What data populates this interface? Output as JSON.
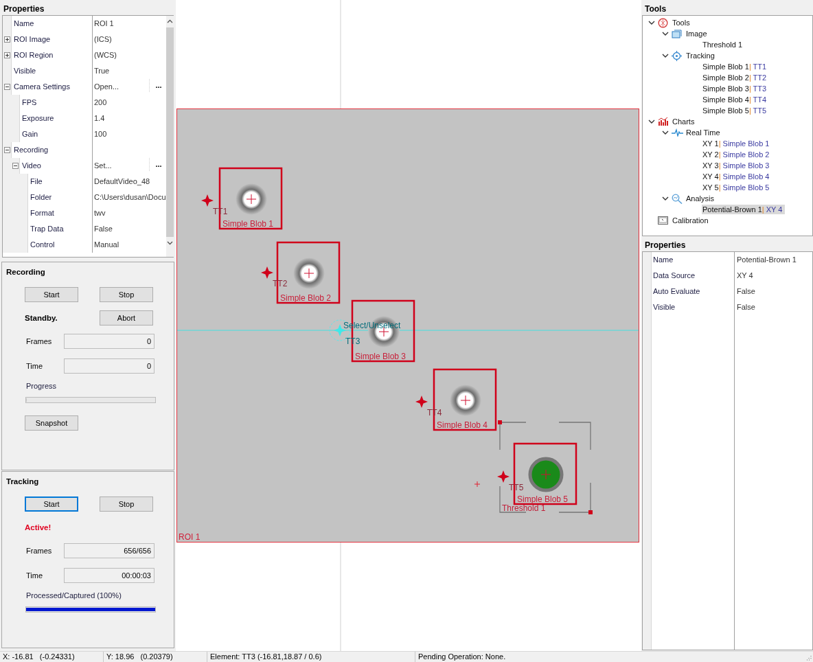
{
  "left_properties": {
    "title": "Properties",
    "rows": [
      {
        "name": "Name",
        "value": "ROI 1"
      },
      {
        "name": "ROI Image",
        "value": "(ICS)",
        "expanded": false
      },
      {
        "name": "ROI Region",
        "value": "(WCS)",
        "expanded": false
      },
      {
        "name": "Visible",
        "value": "True"
      },
      {
        "name": "Camera Settings",
        "value": "Open...",
        "button": "...",
        "expanded": true,
        "children": [
          {
            "name": "FPS",
            "value": "200"
          },
          {
            "name": "Exposure",
            "value": "1.4"
          },
          {
            "name": "Gain",
            "value": "100"
          }
        ]
      },
      {
        "name": "Recording",
        "value": "",
        "expanded": true,
        "children": [
          {
            "name": "Video",
            "value": "Set...",
            "button": "...",
            "expanded": true,
            "children": [
              {
                "name": "File",
                "value": "DefaultVideo_48"
              },
              {
                "name": "Folder",
                "value": "C:\\Users\\dusan\\Docu"
              },
              {
                "name": "Format",
                "value": "twv"
              },
              {
                "name": "Trap Data",
                "value": "False"
              },
              {
                "name": "Control",
                "value": "Manual"
              }
            ]
          }
        ]
      }
    ]
  },
  "recording": {
    "title": "Recording",
    "start": {
      "label": "Start",
      "focused": false
    },
    "stop": "Stop",
    "abort": "Abort",
    "status": {
      "text": "Standby.",
      "kind": "idle"
    },
    "fields": [
      {
        "label": "Frames",
        "value": "0"
      },
      {
        "label": "Time",
        "value": "0"
      }
    ],
    "progress_label": "Progress",
    "progress": {
      "level": 0
    },
    "snapshot": "Snapshot"
  },
  "tracking": {
    "title": "Tracking",
    "start": {
      "label": "Start",
      "focused": true
    },
    "stop": "Stop",
    "status": {
      "text": "Active!",
      "kind": "active"
    },
    "fields": [
      {
        "label": "Frames",
        "value": "656/656"
      },
      {
        "label": "Time",
        "value": "00:00:03"
      }
    ],
    "progress_label": "Processed/Captured (100%)",
    "progress": {
      "level": 1
    }
  },
  "canvas": {
    "roi_label": "ROI 1",
    "selection_hint": "Select/Unselect",
    "threshold_label": "Threshold 1",
    "blobs": [
      {
        "label": "Simple Blob 1",
        "tracker": "TT1",
        "selected": false,
        "detected": false
      },
      {
        "label": "Simple Blob 2",
        "tracker": "TT2",
        "selected": false,
        "detected": false
      },
      {
        "label": "Simple Blob 3",
        "tracker": "TT3",
        "selected": true,
        "detected": false
      },
      {
        "label": "Simple Blob 4",
        "tracker": "TT4",
        "selected": false,
        "detected": false
      },
      {
        "label": "Simple Blob 5",
        "tracker": "TT5",
        "selected": false,
        "detected": true
      }
    ]
  },
  "tools": {
    "title": "Tools",
    "tree": [
      {
        "label": "Tools",
        "kind": "tools",
        "expanded": true,
        "selected": false,
        "children": [
          {
            "label": "Image",
            "kind": "image",
            "expanded": true,
            "selected": false,
            "children": [
              {
                "label": "Threshold 1",
                "selected": false
              }
            ]
          },
          {
            "label": "Tracking",
            "kind": "tracking",
            "expanded": true,
            "selected": false,
            "children": [
              {
                "label": "Simple Blob 1",
                "separator": "|",
                "ref": "TT1",
                "selected": false
              },
              {
                "label": "Simple Blob 2",
                "separator": "|",
                "ref": "TT2",
                "selected": false
              },
              {
                "label": "Simple Blob 3",
                "separator": "|",
                "ref": "TT3",
                "selected": false
              },
              {
                "label": "Simple Blob 4",
                "separator": "|",
                "ref": "TT4",
                "selected": false
              },
              {
                "label": "Simple Blob 5",
                "separator": "|",
                "ref": "TT5",
                "selected": false
              }
            ]
          }
        ]
      },
      {
        "label": "Charts",
        "kind": "charts",
        "expanded": true,
        "selected": false,
        "children": [
          {
            "label": "Real Time",
            "kind": "realtime",
            "expanded": true,
            "selected": false,
            "children": [
              {
                "label": "XY 1",
                "separator": "|",
                "ref": "Simple Blob 1",
                "selected": false
              },
              {
                "label": "XY 2",
                "separator": "|",
                "ref": "Simple Blob 2",
                "selected": false
              },
              {
                "label": "XY 3",
                "separator": "|",
                "ref": "Simple Blob 3",
                "selected": false
              },
              {
                "label": "XY 4",
                "separator": "|",
                "ref": "Simple Blob 4",
                "selected": false
              },
              {
                "label": "XY 5",
                "separator": "|",
                "ref": "Simple Blob 5",
                "selected": false
              }
            ]
          },
          {
            "label": "Analysis",
            "kind": "analysis",
            "expanded": true,
            "selected": false,
            "children": [
              {
                "label": "Potential-Brown 1",
                "separator": "|",
                "ref": "XY 4",
                "selected": true
              }
            ]
          }
        ]
      },
      {
        "label": "Calibration",
        "kind": "calibration",
        "selected": false
      }
    ]
  },
  "right_properties": {
    "title": "Properties",
    "rows": [
      {
        "name": "Name",
        "value": "Potential-Brown 1"
      },
      {
        "name": "Data Source",
        "value": "XY 4"
      },
      {
        "name": "Auto Evaluate",
        "value": "False"
      },
      {
        "name": "Visible",
        "value": "False"
      }
    ]
  },
  "status_bar": [
    "X: -16.81   (-0.24331)",
    "Y: 18.96   (0.20379)",
    "Element: TT3 (-16.81,18.87 / 0.6)",
    "Pending Operation: None."
  ]
}
